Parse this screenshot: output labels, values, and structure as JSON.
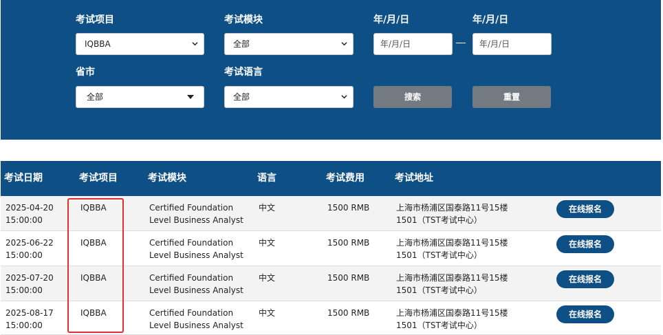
{
  "filters": {
    "project": {
      "label": "考试项目",
      "value": "IQBBA"
    },
    "module": {
      "label": "考试模块",
      "value": "全部"
    },
    "date_from": {
      "label": "年/月/日",
      "placeholder": "年/月/日"
    },
    "date_to": {
      "label": "年/月/日",
      "placeholder": "年/月/日"
    },
    "province": {
      "label": "省市",
      "value": "全部"
    },
    "language": {
      "label": "考试语言",
      "value": "全部"
    },
    "search_button": "搜索",
    "reset_button": "重置"
  },
  "table": {
    "headers": {
      "date": "考试日期",
      "project": "考试项目",
      "module": "考试模块",
      "language": "语言",
      "fee": "考试费用",
      "address": "考试地址"
    },
    "rows": [
      {
        "date": "2025-04-20 15:00:00",
        "project": "IQBBA",
        "module": "Certified Foundation Level Business Analyst",
        "language": "中文",
        "fee": "1500 RMB",
        "address": "上海市杨浦区国泰路11号15楼1501（TST考试中心）",
        "action": "在线报名"
      },
      {
        "date": "2025-06-22 15:00:00",
        "project": "IQBBA",
        "module": "Certified Foundation Level Business Analyst",
        "language": "中文",
        "fee": "1500 RMB",
        "address": "上海市杨浦区国泰路11号15楼1501（TST考试中心）",
        "action": "在线报名"
      },
      {
        "date": "2025-07-20 15:00:00",
        "project": "IQBBA",
        "module": "Certified Foundation Level Business Analyst",
        "language": "中文",
        "fee": "1500 RMB",
        "address": "上海市杨浦区国泰路11号15楼1501（TST考试中心）",
        "action": "在线报名"
      },
      {
        "date": "2025-08-17 15:00:00",
        "project": "IQBBA",
        "module": "Certified Foundation Level Business Analyst",
        "language": "中文",
        "fee": "1500 RMB",
        "address": "上海市杨浦区国泰路11号15楼1501（TST考试中心）",
        "action": "在线报名"
      }
    ]
  },
  "colors": {
    "brand_blue": "#0e4f85",
    "button_gray": "#747a82",
    "highlight_red": "#e0302c"
  },
  "icons": {
    "select_arrow": "chevron-down-icon",
    "province_arrow": "caret-down-icon"
  }
}
